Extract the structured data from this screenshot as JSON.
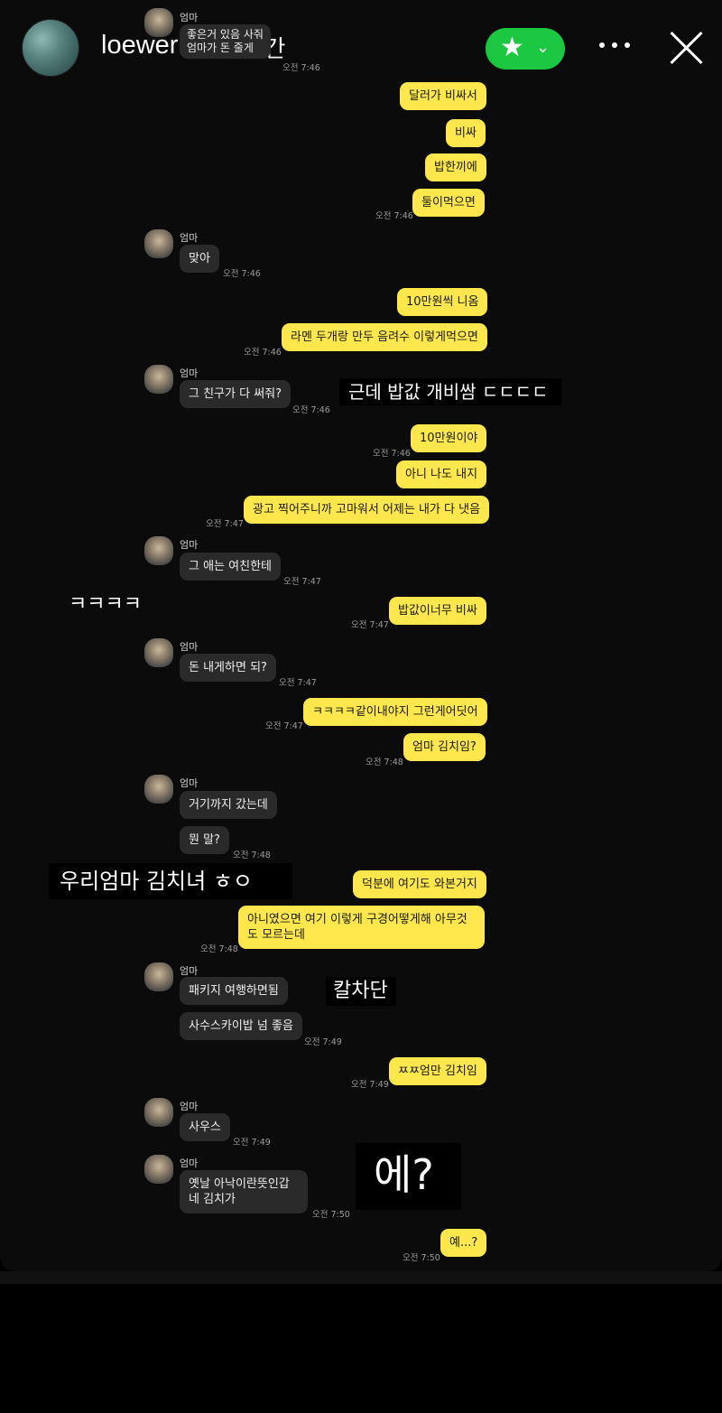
{
  "header": {
    "username": "loeweruby",
    "time_ago": "1시간",
    "star_glyph": "★",
    "chevron_glyph": "⌄",
    "icons": [
      "avatar",
      "close-friends-star-icon",
      "chevron-down-icon",
      "more-icon",
      "close-icon"
    ],
    "close_friends_color": "#1cc841"
  },
  "chat": {
    "mom_name": "엄마",
    "messages": [
      {
        "text": "좋은거 있음 사줘",
        "time": ""
      },
      {
        "text": "엄마가 돈 줄게",
        "time": "오전 7:46"
      },
      {
        "text": "달러가 비싸서"
      },
      {
        "text": "비싸"
      },
      {
        "text": "밥한끼에"
      },
      {
        "text": "둘이먹으면",
        "time": "오전 7:46"
      },
      {
        "text": "맞아",
        "time": "오전 7:46"
      },
      {
        "text": "10만원씩 니옴"
      },
      {
        "text": "라멘 두개랑 만두 음려수 이렇게먹으면",
        "time": "오전 7:46"
      },
      {
        "text": "그 친구가 다 써줘?",
        "time": "오전 7:46"
      },
      {
        "text": "10만원이야",
        "time": "오전 7:46"
      },
      {
        "text": "아니 나도 내지"
      },
      {
        "text": "광고 찍어주니까 고마워서 어제는 내가 다 냇음",
        "time": "오전 7:47"
      },
      {
        "text": "그 애는 여친한테",
        "time": "오전 7:47"
      },
      {
        "text": "밥값이너무 비싸",
        "time": "오전 7:47"
      },
      {
        "text": "돈 내게하면 되?",
        "time": "오전 7:47"
      },
      {
        "text": "ㅋㅋㅋㅋ같이내야지 그런게어딧어",
        "time": "오전 7:47"
      },
      {
        "text": "엄마 김치임?",
        "time": "오전 7:48"
      },
      {
        "text": "거기까지 갔는데"
      },
      {
        "text": "뭔 말?",
        "time": "오전 7:48"
      },
      {
        "text": "덕분에 여기도 와본거지"
      },
      {
        "text": "아니였으면 여기 이렇게 구경어떻게해 아무것도 모르는데",
        "time": "오전 7:48"
      },
      {
        "text": "패키지 여행하면됨"
      },
      {
        "text": "사수스카이밥 넘 좋음",
        "time": "오전 7:49"
      },
      {
        "text": "ㅉㅉ엄만 김치임",
        "time": "오전 7:49"
      },
      {
        "text": "사우스",
        "time": "오전 7:49"
      },
      {
        "text": "옛날 아낙이란뜻인갑네 김치가",
        "time": "오전 7:50"
      },
      {
        "text": "예...?",
        "time": "오전 7:50"
      }
    ]
  },
  "stickers": {
    "s1": "근데 밥값 개비쌈 ㄷㄷㄷㄷ",
    "s2": "ㅋㅋㅋㅋ",
    "s3": "우리엄마 김치녀 ㅎㅇ",
    "s4": "칼차단",
    "s5": "에?"
  },
  "colors": {
    "outgoing_bubble": "#fde74d",
    "incoming_bubble": "#2a2a2a",
    "background": "#0b0b0b"
  }
}
